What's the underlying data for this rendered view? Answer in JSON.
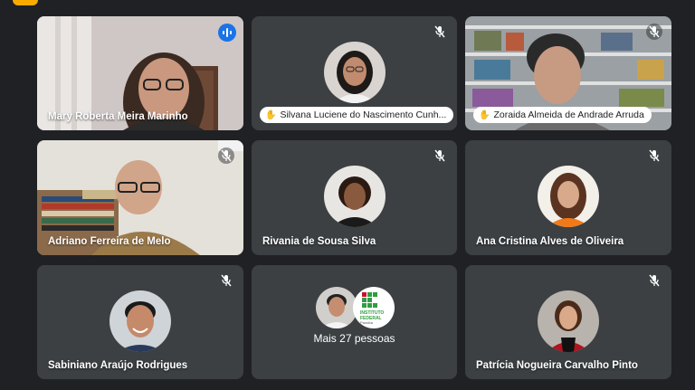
{
  "tiles": [
    {
      "name": "Mary Roberta Meira Marinho",
      "muted": false,
      "speaking": true
    },
    {
      "name": "Silvana Luciene do Nascimento Cunh...",
      "muted": true
    },
    {
      "name": "Zoraida Almeida de Andrade Arruda",
      "muted": true
    },
    {
      "name": "Adriano Ferreira de Melo",
      "muted": true
    },
    {
      "name": "Rivania de Sousa Silva",
      "muted": true
    },
    {
      "name": "Ana Cristina Alves de Oliveira",
      "muted": true
    },
    {
      "name": "Sabiniano Araújo Rodrigues",
      "muted": true
    },
    {
      "name": "Mais 27 pessoas",
      "logo_text": [
        "INSTITUTO",
        "FEDERAL",
        "Paraíba"
      ]
    },
    {
      "name": "Patrícia Nogueira Carvalho Pinto",
      "muted": true
    }
  ],
  "icons": {
    "muted": "mic-off-icon",
    "speaking": "audio-level-icon",
    "hand": "hand-icon"
  },
  "colors": {
    "background": "#202124",
    "tile": "#3c4043",
    "speaking_border": "#8ab4f8",
    "accent": "#f9ab00"
  }
}
